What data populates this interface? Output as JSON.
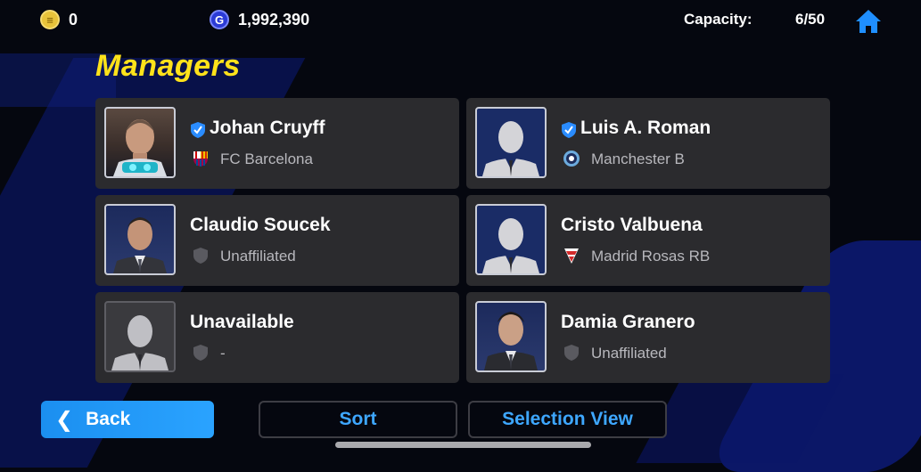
{
  "topbar": {
    "coins": "0",
    "gp": "1,992,390",
    "capacity_label": "Capacity:",
    "capacity_value": "6/50"
  },
  "title": "Managers",
  "managers": [
    {
      "name": "Johan Cruyff",
      "club": "FC Barcelona",
      "verified": true,
      "portrait": "photo",
      "club_icon": "barcelona-crest"
    },
    {
      "name": "Luis A. Roman",
      "club": "Manchester B",
      "verified": true,
      "portrait": "silhouette-navy",
      "club_icon": "manchester-crest"
    },
    {
      "name": "Claudio Soucek",
      "club": "Unaffiliated",
      "verified": false,
      "portrait": "photo",
      "club_icon": "shield-gray"
    },
    {
      "name": "Cristo Valbuena",
      "club": "Madrid Rosas RB",
      "verified": false,
      "portrait": "silhouette-navy",
      "club_icon": "madrid-rosas-crest"
    },
    {
      "name": "Unavailable",
      "club": "-",
      "verified": false,
      "portrait": "silhouette-gray",
      "club_icon": "shield-gray"
    },
    {
      "name": "Damia Granero",
      "club": "Unaffiliated",
      "verified": false,
      "portrait": "photo",
      "club_icon": "shield-gray"
    }
  ],
  "buttons": {
    "back": "Back",
    "sort": "Sort",
    "selection_view": "Selection View"
  },
  "colors": {
    "title": "#ffe21a",
    "accent": "#3ea7ff",
    "card": "#2b2b2e",
    "back_button": "#1b8ff0"
  }
}
